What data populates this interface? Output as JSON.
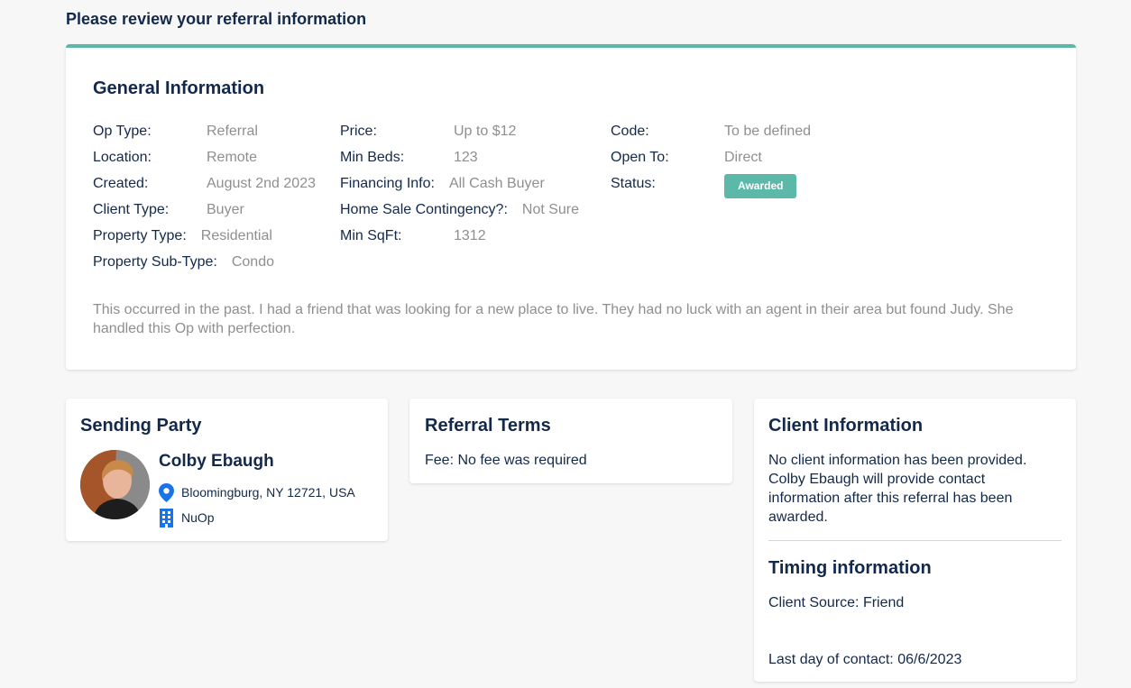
{
  "page": {
    "title": "Please review your referral information"
  },
  "general": {
    "title": "General Information",
    "col1": [
      {
        "label": "Op Type:",
        "value": "Referral"
      },
      {
        "label": "Location:",
        "value": "Remote"
      },
      {
        "label": "Created:",
        "value": "August 2nd 2023"
      },
      {
        "label": "Client Type:",
        "value": "Buyer"
      },
      {
        "label": "Property Type:",
        "value": "Residential"
      },
      {
        "label": "Property Sub-Type:",
        "value": "Condo"
      }
    ],
    "col2": [
      {
        "label": "Price:",
        "value": "Up to $12"
      },
      {
        "label": "Min Beds:",
        "value": "123"
      },
      {
        "label": "Financing Info:",
        "value": "All Cash Buyer"
      },
      {
        "label": "Home Sale Contingency?:",
        "value": "Not Sure"
      },
      {
        "label": "Min SqFt:",
        "value": "1312"
      }
    ],
    "col3": [
      {
        "label": "Code:",
        "value": "To be defined"
      },
      {
        "label": "Open To:",
        "value": "Direct"
      },
      {
        "label": "Status:",
        "value": "Awarded"
      }
    ],
    "description": "This occurred in the past. I had a friend that was looking for a new place to live. They had no luck with an agent in their area but found Judy. She handled this Op with perfection.",
    "accent_color": "#5cb8a8"
  },
  "sending": {
    "title": "Sending Party",
    "name": "Colby Ebaugh",
    "location": "Bloomingburg, NY 12721, USA",
    "company": "NuOp",
    "location_icon": "map-pin-icon",
    "company_icon": "building-icon",
    "icon_color": "#1a73e8"
  },
  "terms": {
    "title": "Referral Terms",
    "fee": "Fee: No fee was required"
  },
  "client": {
    "title": "Client Information",
    "text": "No client information has been provided. Colby Ebaugh will provide contact information after this referral has been awarded.",
    "timing_title": "Timing information",
    "source": "Client Source: Friend",
    "last_contact": "Last day of contact: 06/6/2023"
  }
}
